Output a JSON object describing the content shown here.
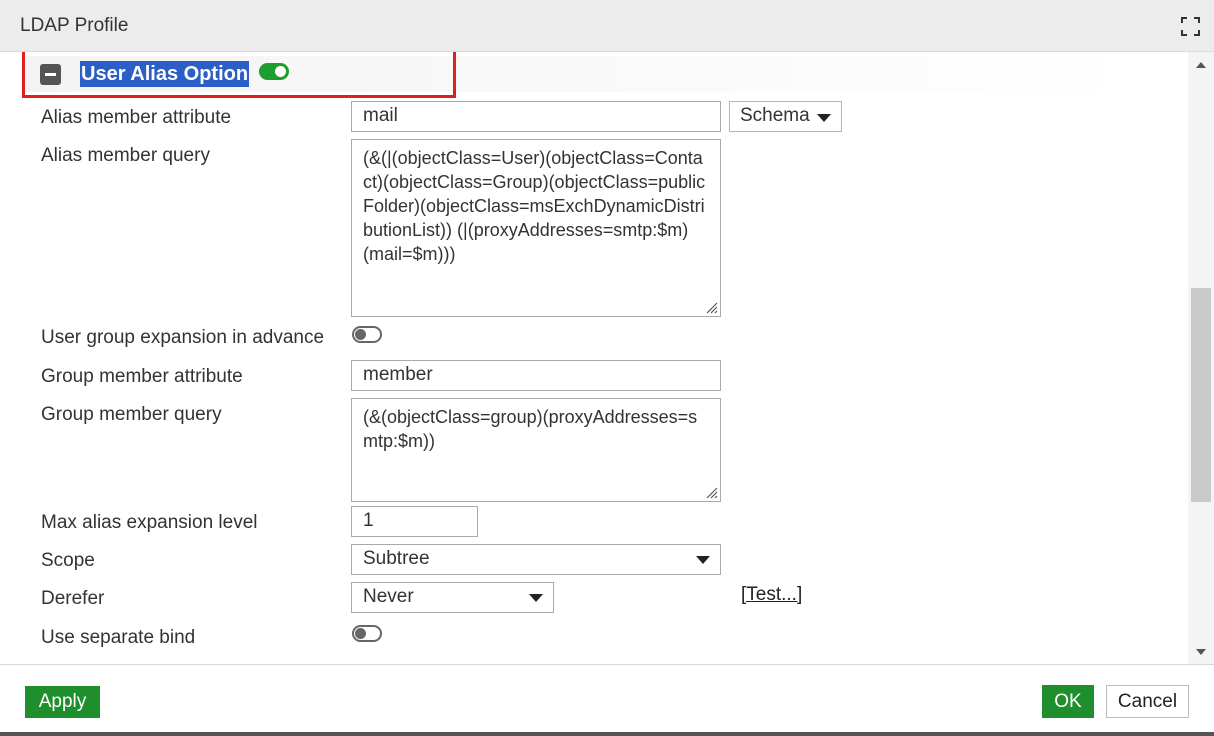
{
  "window": {
    "title": "LDAP Profile"
  },
  "section": {
    "title": "User Alias Option",
    "enabled": true
  },
  "fields": {
    "alias_member_attribute": {
      "label": "Alias member attribute",
      "value": "mail"
    },
    "schema_button": {
      "label": "Schema"
    },
    "alias_member_query": {
      "label": "Alias member query",
      "value": "(&(|(objectClass=User)(objectClass=Contact)(objectClass=Group)(objectClass=publicFolder)(objectClass=msExchDynamicDistributionList)) (|(proxyAddresses=smtp:$m)(mail=$m)))"
    },
    "user_group_expansion": {
      "label": "User group expansion in advance",
      "enabled": false
    },
    "group_member_attribute": {
      "label": "Group member attribute",
      "value": "member"
    },
    "group_member_query": {
      "label": "Group member query",
      "value": "(&(objectClass=group)(proxyAddresses=smtp:$m))"
    },
    "max_alias_expansion_level": {
      "label": "Max alias expansion level",
      "value": "1"
    },
    "scope": {
      "label": "Scope",
      "value": "Subtree"
    },
    "derefer": {
      "label": "Derefer",
      "value": "Never"
    },
    "test_link": {
      "label": "[Test...]"
    },
    "use_separate_bind": {
      "label": "Use separate bind",
      "enabled": false
    }
  },
  "footer": {
    "apply_label": "Apply",
    "ok_label": "OK",
    "cancel_label": "Cancel"
  },
  "colors": {
    "accent_green": "#1f8f2d",
    "highlight_red": "#e02020",
    "selection_blue": "#2b5fc7"
  },
  "icons": {
    "maximize": "maximize-icon",
    "collapse": "minus-square-icon"
  }
}
